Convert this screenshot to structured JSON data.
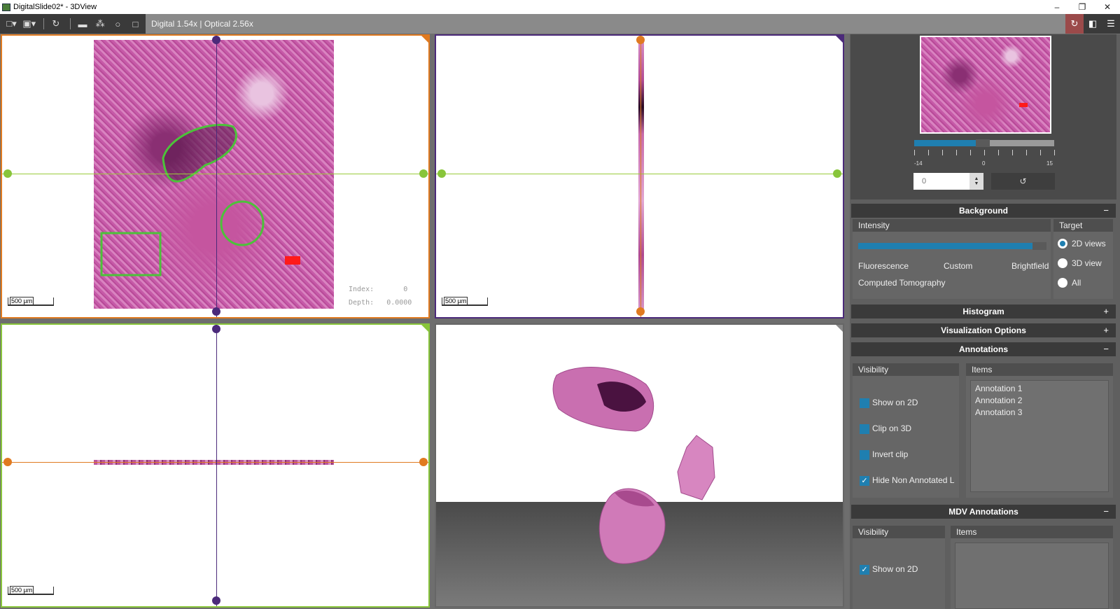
{
  "window": {
    "title": "DigitalSlide02* - 3DView"
  },
  "toolbar": {
    "zoom_text": "Digital 1.54x | Optical 2.56x"
  },
  "views": {
    "scale_label": "500 µm",
    "xy_overlay": {
      "index_label": "Index:",
      "index_value": "0",
      "depth_label": "Depth:",
      "depth_value": "0.0000"
    }
  },
  "navigator": {
    "slider": {
      "min_label": "-14",
      "mid_label": "0",
      "max_label": "15",
      "level_fraction": 0.44
    },
    "spin_value": "0"
  },
  "background": {
    "title": "Background",
    "toggle": "−",
    "intensity_label": "Intensity",
    "target_label": "Target",
    "slider_level_fraction": 0.93,
    "options": [
      "Fluorescence",
      "Custom",
      "Brightfield"
    ],
    "computed_tomography": "Computed Tomography",
    "targets": [
      {
        "label": "2D views",
        "selected": true
      },
      {
        "label": "3D view",
        "selected": false
      },
      {
        "label": "All",
        "selected": false
      }
    ]
  },
  "histogram": {
    "title": "Histogram",
    "toggle": "+"
  },
  "visualization": {
    "title": "Visualization Options",
    "toggle": "+"
  },
  "annotations": {
    "title": "Annotations",
    "toggle": "−",
    "visibility_label": "Visibility",
    "items_label": "Items",
    "checks": [
      {
        "label": "Show on 2D",
        "checked": false
      },
      {
        "label": "Clip on 3D",
        "checked": false
      },
      {
        "label": "Invert clip",
        "checked": false
      },
      {
        "label": "Hide Non Annotated La",
        "checked": true
      }
    ],
    "items": [
      "Annotation 1",
      "Annotation 2",
      "Annotation 3"
    ]
  },
  "mdv": {
    "title": "MDV Annotations",
    "toggle": "−",
    "visibility_label": "Visibility",
    "items_label": "Items",
    "checks": [
      {
        "label": "Show on 2D",
        "checked": true
      }
    ]
  },
  "colors": {
    "accent": "#1f7fb0",
    "xy_border": "#e07a20",
    "yz_border": "#4b2a7a",
    "xz_border": "#88c53a",
    "annotation": "#4cc23a",
    "marker": "#ff1a1a"
  }
}
